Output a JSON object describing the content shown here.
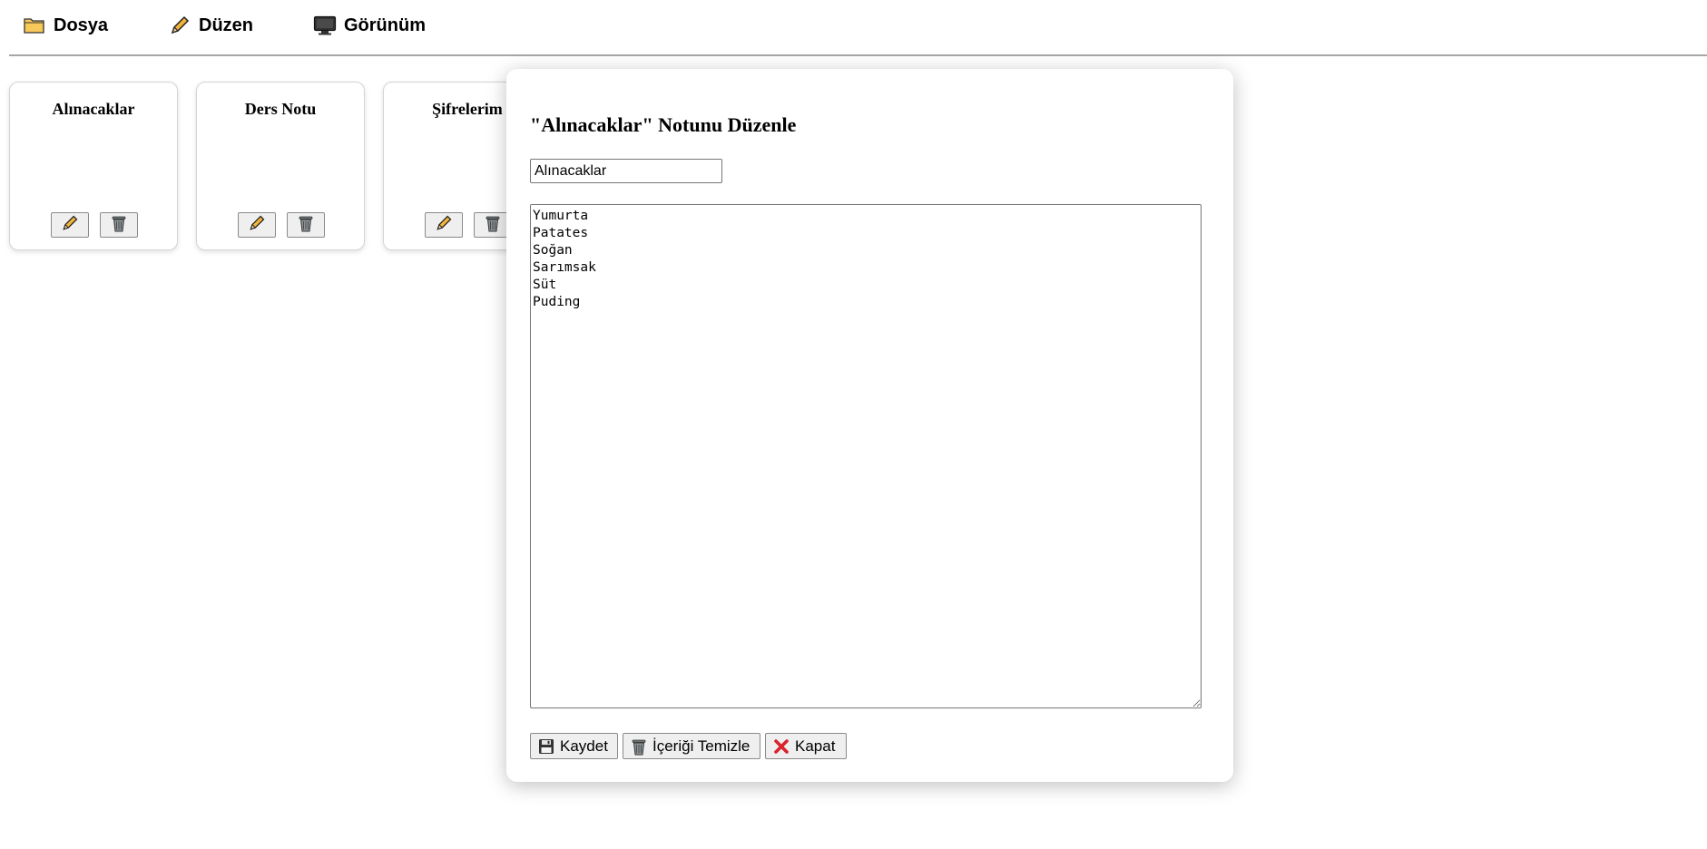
{
  "menu": {
    "file_label": "Dosya",
    "edit_label": "Düzen",
    "view_label": "Görünüm"
  },
  "notes": [
    {
      "title": "Alınacaklar"
    },
    {
      "title": "Ders Notu"
    },
    {
      "title": "Şifrelerim"
    }
  ],
  "modal": {
    "title": "\"Alınacaklar\" Notunu Düzenle",
    "title_input_value": "Alınacaklar",
    "content": "Yumurta\nPatates\nSoğan\nSarımsak\nSüt\nPuding",
    "save_label": "Kaydet",
    "clear_label": "İçeriği Temizle",
    "close_label": "Kapat"
  },
  "icons": {
    "file": "folder-icon",
    "edit": "pencil-icon",
    "view": "monitor-icon",
    "delete": "trash-icon",
    "save": "floppy-disk-icon",
    "close": "red-x-icon"
  },
  "colors": {
    "folder": "#f7c95a",
    "pencil": "#f2b43a",
    "close_x": "#d9232d",
    "button_bg": "#efefef"
  }
}
